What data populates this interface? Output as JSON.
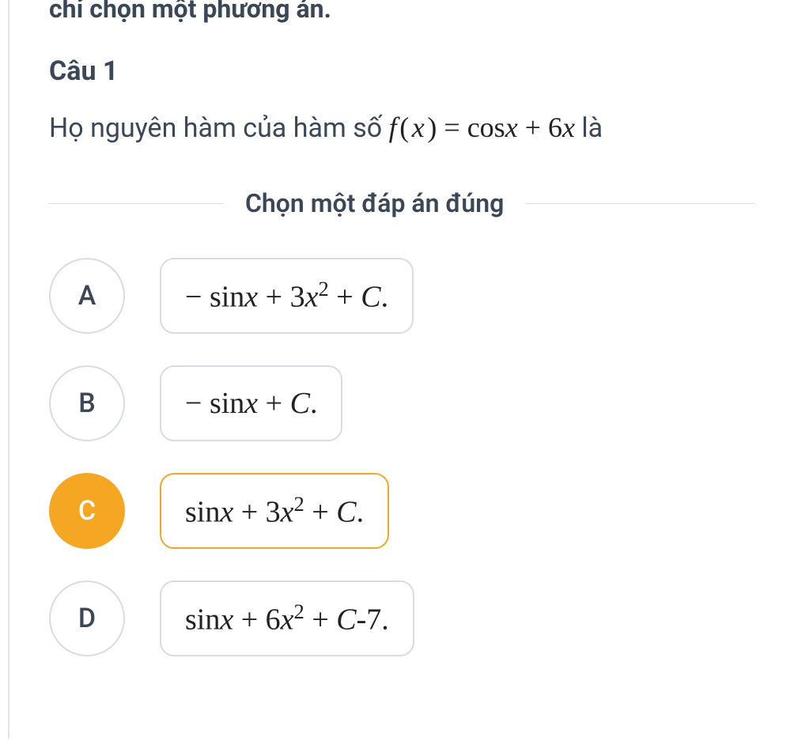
{
  "top_instruction": "chỉ chọn một phương án.",
  "question": {
    "title": "Câu 1",
    "prefix": "Họ nguyên hàm của hàm số ",
    "formula_html": "<span class='math'>f<span class='sp'></span><span class='rm'>(</span><span class='sp'></span>x<span class='sp'></span><span class='rm'>)</span> <span class='rm'>=</span> <span class='rm'>cos</span>x <span class='rm'>+</span> <span class='rm'>6</span>x</span>",
    "suffix": " là"
  },
  "choose_label": "Chọn một đáp án đúng",
  "options": [
    {
      "letter": "A",
      "selected": false,
      "html": "<span class='math'><span class='rm'>&minus;</span> <span class='rm'>sin</span>x <span class='rm'>+</span> <span class='rm'>3</span>x<sup>2</sup> <span class='rm'>+</span> C<span class='rm'>.</span></span>"
    },
    {
      "letter": "B",
      "selected": false,
      "html": "<span class='math'><span class='rm'>&minus;</span> <span class='rm'>sin</span>x <span class='rm'>+</span> C<span class='rm'>.</span></span>"
    },
    {
      "letter": "C",
      "selected": true,
      "html": "<span class='math'><span class='rm'>sin</span>x <span class='rm'>+</span> <span class='rm'>3</span>x<sup>2</sup> <span class='rm'>+</span> C<span class='rm'>.</span></span>"
    },
    {
      "letter": "D",
      "selected": false,
      "html": "<span class='math'><span class='rm'>sin</span>x <span class='rm'>+</span> <span class='rm'>6</span>x<sup>2</sup> <span class='rm'>+</span> C<span class='rm'>-7.</span></span>"
    }
  ]
}
